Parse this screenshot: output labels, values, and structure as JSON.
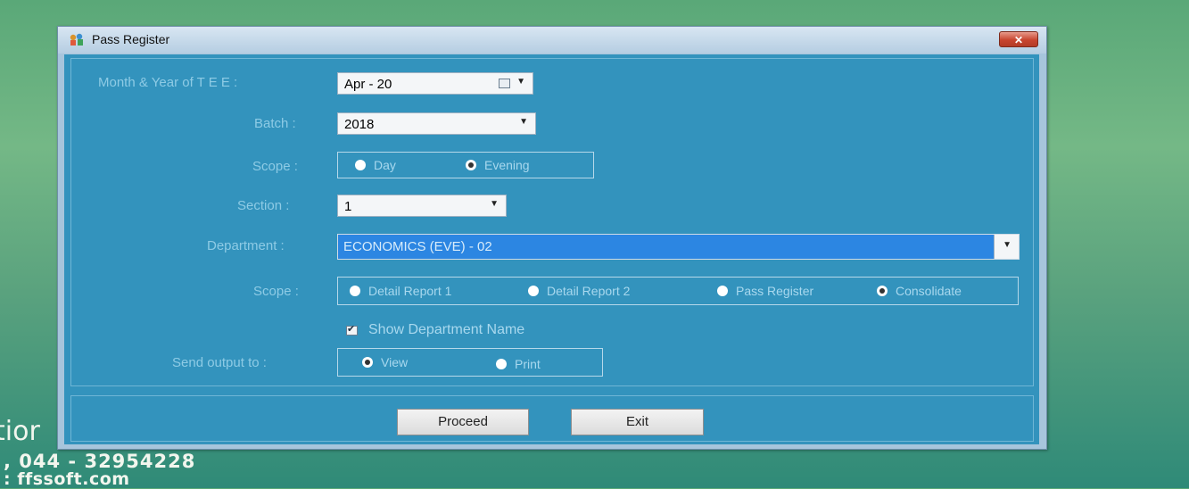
{
  "background": {
    "title_fragment": "tior",
    "phone": ", 044 - 32954228",
    "website": ": ffssoft.com"
  },
  "window": {
    "title": "Pass Register",
    "close_icon": "close-icon"
  },
  "form": {
    "month_year_label": "Month & Year of T E E :",
    "month_year_value": "Apr  - 20",
    "batch_label": "Batch :",
    "batch_value": "2018",
    "scope_label": "Scope :",
    "scope_options": [
      "Day",
      "Evening"
    ],
    "scope_selected": "Evening",
    "section_label": "Section :",
    "section_value": "1",
    "department_label": "Department :",
    "department_value": "ECONOMICS (EVE) - 02",
    "report_scope_label": "Scope :",
    "report_scope_options": [
      "Detail Report 1",
      "Detail Report 2",
      "Pass Register",
      "Consolidate"
    ],
    "report_scope_selected": "Consolidate",
    "show_department_name_label": "Show Department Name",
    "show_department_name_checked": true,
    "output_label": "Send output to :",
    "output_options": [
      "View",
      "Print"
    ],
    "output_selected": "View"
  },
  "buttons": {
    "proceed": "Proceed",
    "exit": "Exit"
  },
  "colors": {
    "window_client": "#3393bd",
    "department_highlight": "#2c86e2",
    "close_button": "#c8452f"
  }
}
